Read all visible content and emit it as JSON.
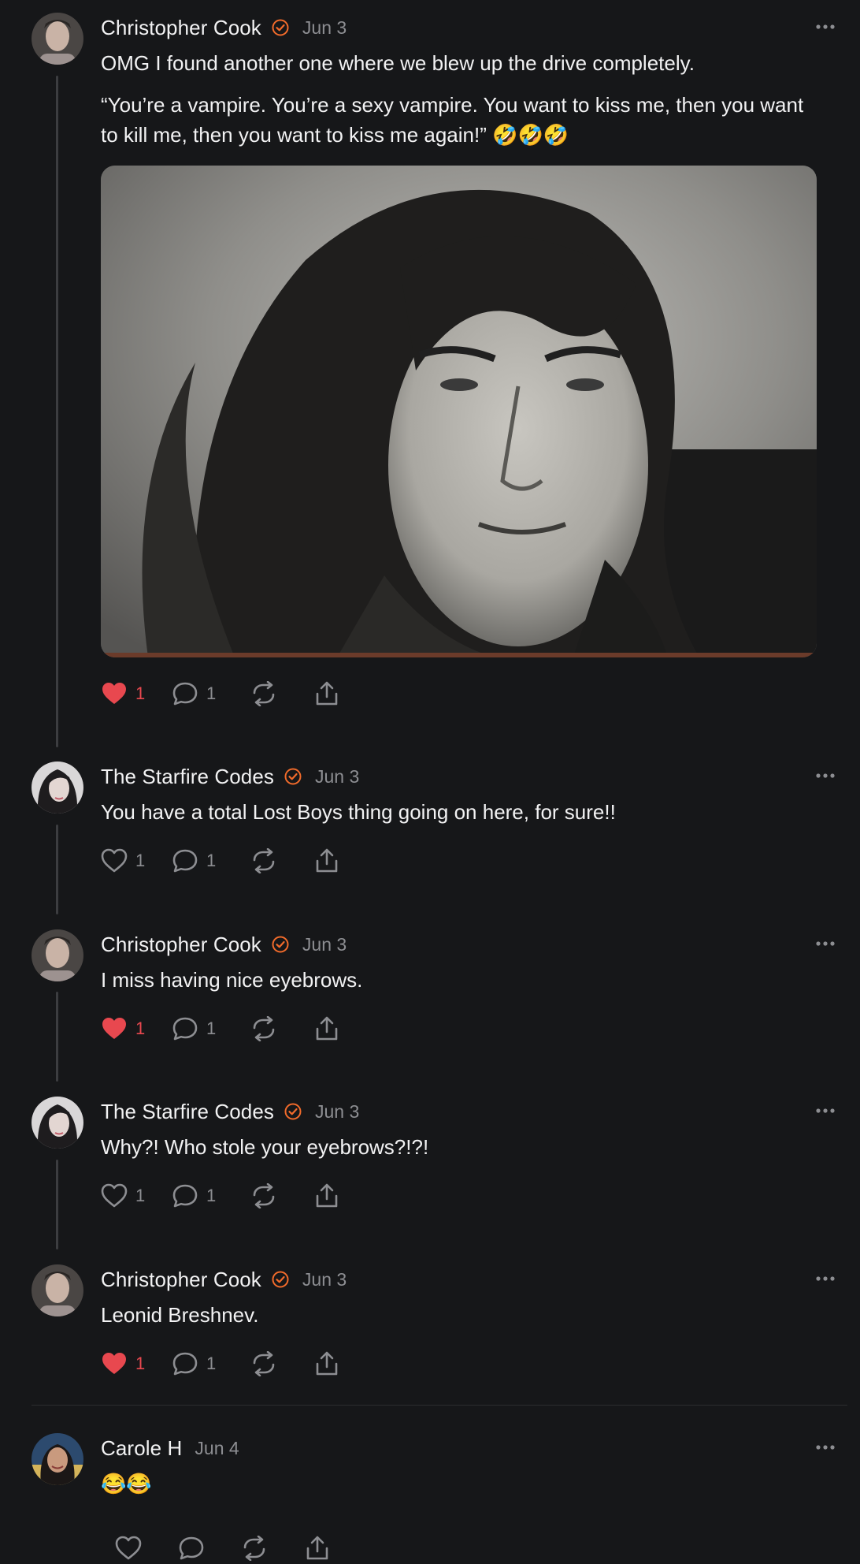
{
  "colors": {
    "background": "#161719",
    "accent_verified": "#f26b2b",
    "like_red": "#e8484f",
    "muted": "#8d8e92",
    "text": "#f2f2f3"
  },
  "posts": [
    {
      "author": "Christopher Cook",
      "verified": true,
      "date": "Jun 3",
      "text": [
        "OMG I found another one where we blew up the drive completely.",
        "“You’re a vampire. You’re a sexy vampire. You want to kiss me, then you want to kill me, then you want to kiss me again!” 🤣🤣🤣"
      ],
      "media": "vampire-portrait-photo",
      "liked": true,
      "likes": "1",
      "replies": "1"
    },
    {
      "author": "The Starfire Codes",
      "verified": true,
      "date": "Jun 3",
      "text": [
        "You have a total Lost Boys thing going on here, for sure!!"
      ],
      "liked": false,
      "likes": "1",
      "replies": "1"
    },
    {
      "author": "Christopher Cook",
      "verified": true,
      "date": "Jun 3",
      "text": [
        "I miss having nice eyebrows."
      ],
      "liked": true,
      "likes": "1",
      "replies": "1"
    },
    {
      "author": "The Starfire Codes",
      "verified": true,
      "date": "Jun 3",
      "text": [
        "Why?! Who stole your eyebrows?!?!"
      ],
      "liked": false,
      "likes": "1",
      "replies": "1"
    },
    {
      "author": "Christopher Cook",
      "verified": true,
      "date": "Jun 3",
      "text": [
        "Leonid Breshnev."
      ],
      "liked": true,
      "likes": "1",
      "replies": "1"
    },
    {
      "author": "Carole H",
      "verified": false,
      "date": "Jun 4",
      "text": [
        "😂😂"
      ],
      "liked": false,
      "likes": "",
      "replies": ""
    }
  ],
  "icons": {
    "verified": "verified-badge-icon",
    "more": "more-options-icon",
    "like": "heart-icon",
    "reply": "comment-icon",
    "repost": "repost-icon",
    "share": "share-icon"
  }
}
